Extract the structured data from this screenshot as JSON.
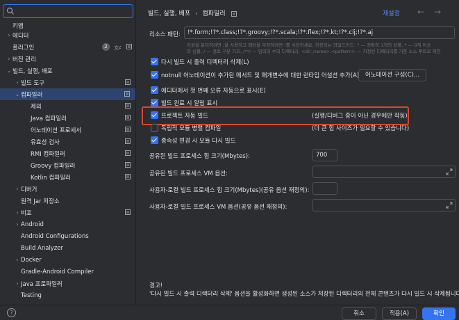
{
  "search": {
    "value": "",
    "placeholder": ""
  },
  "sidebar": {
    "items": [
      {
        "label": "키맵",
        "arrow": ""
      },
      {
        "label": "에디터",
        "arrow": "›"
      },
      {
        "label": "플러그인",
        "arrow": "",
        "badge": "2"
      },
      {
        "label": "버전 관리",
        "arrow": "›"
      },
      {
        "label": "빌드, 실행, 배포",
        "arrow": "⌄"
      },
      {
        "label": "빌드 도구",
        "arrow": "›"
      },
      {
        "label": "컴파일러",
        "arrow": "⌄"
      },
      {
        "label": "제외",
        "arrow": ""
      },
      {
        "label": "Java 컴파일러",
        "arrow": ""
      },
      {
        "label": "어노테이션 프로세서",
        "arrow": ""
      },
      {
        "label": "유효성 검사",
        "arrow": ""
      },
      {
        "label": "RMI 컴파일러",
        "arrow": ""
      },
      {
        "label": "Groovy 컴파일러",
        "arrow": ""
      },
      {
        "label": "Kotlin 컴파일러",
        "arrow": ""
      },
      {
        "label": "디버거",
        "arrow": "›"
      },
      {
        "label": "원격 Jar 저장소",
        "arrow": ""
      },
      {
        "label": "비포",
        "arrow": "›"
      },
      {
        "label": "Android",
        "arrow": "›"
      },
      {
        "label": "Android Configurations",
        "arrow": ""
      },
      {
        "label": "Build Analyzer",
        "arrow": ""
      },
      {
        "label": "Docker",
        "arrow": "›"
      },
      {
        "label": "Gradle-Android Compiler",
        "arrow": ""
      },
      {
        "label": "Java 프로파일러",
        "arrow": "›"
      },
      {
        "label": "Testing",
        "arrow": ""
      }
    ]
  },
  "header": {
    "breadcrumb_parent": "빌드, 실행, 배포",
    "breadcrumb_sep": "›",
    "breadcrumb_current": "컴파일러",
    "reset": "재설정",
    "back": "←",
    "forward": "→"
  },
  "resource": {
    "label": "리소스 패턴:",
    "value": "!*.form;!?*.class;!?*.groovy;!?*.scala;!?*.flex;!?*.kt;!?*.clj;!?*.aj",
    "hint1": "지원을 분리하려면 ;을 사용하고 패턴을 부정하려면 !를 사용하세요. 허용되는 와일드카드: ? — 정확히 1개의 심볼, * — 0개 이상",
    "hint2": "의 심볼, / — 경로 구분 기호, /**/ — 임의의 수의 디렉터리, <dir_name>:<pattern> — 지정된 디렉터리를 기준 소스 루트로 제한"
  },
  "options": {
    "clear_output": "다시 빌드 시 출력 디렉터리 삭제(L)",
    "notnull": "notnull 어노테이션이 추가된 메서드 및 매개변수에 대한 런타임 어설션 추가(A)",
    "annotation_btn": "어노테이션 구성(C)...",
    "auto_show": "에디터에서 첫 번째 오류 자동으로 표시(E)",
    "notify": "빌드 완료 시 알림 표시",
    "auto_build": "프로젝트 자동 빌드",
    "auto_build_note": "(실행/디버그 중이 아닌 경우에만 작동)",
    "parallel": "독립적 모듈 병렬 컴파일",
    "parallel_note": "(더 큰 힙 사이즈가 필요할 수 있습니다)",
    "rebuild": "종속성 변경 시 모듈 다시 빌드"
  },
  "fields": {
    "heap_label": "공유된 빌드 프로세스 힙 크기(Mbytes):",
    "heap_value": "700",
    "vm_label": "공유된 빌드 프로세스 VM 옵션:",
    "vm_value": "",
    "user_heap_label": "사용자-로컬 빌드 프로세스 힙 크기(Mbytes)(공유 옵션 재정의):",
    "user_heap_value": "",
    "user_vm_label": "사용자-로컬 빌드 프로세스 VM 옵션(공유 옵션 재정의):",
    "user_vm_value": ""
  },
  "warning": {
    "title": "경고!",
    "text": "'다시 빌드 시 출력 디렉터리 삭제' 옵션을 활성화하면 생성된 소스가 저장된 디렉터리의 전체 콘텐츠가 다시 빌드 시 삭제됩니다."
  },
  "footer": {
    "help": "?",
    "cancel": "취소",
    "apply": "적용(A)",
    "ok": "확인"
  },
  "colors": {
    "accent": "#3574f0",
    "highlight": "#d9472f",
    "selection": "#2e436e"
  }
}
